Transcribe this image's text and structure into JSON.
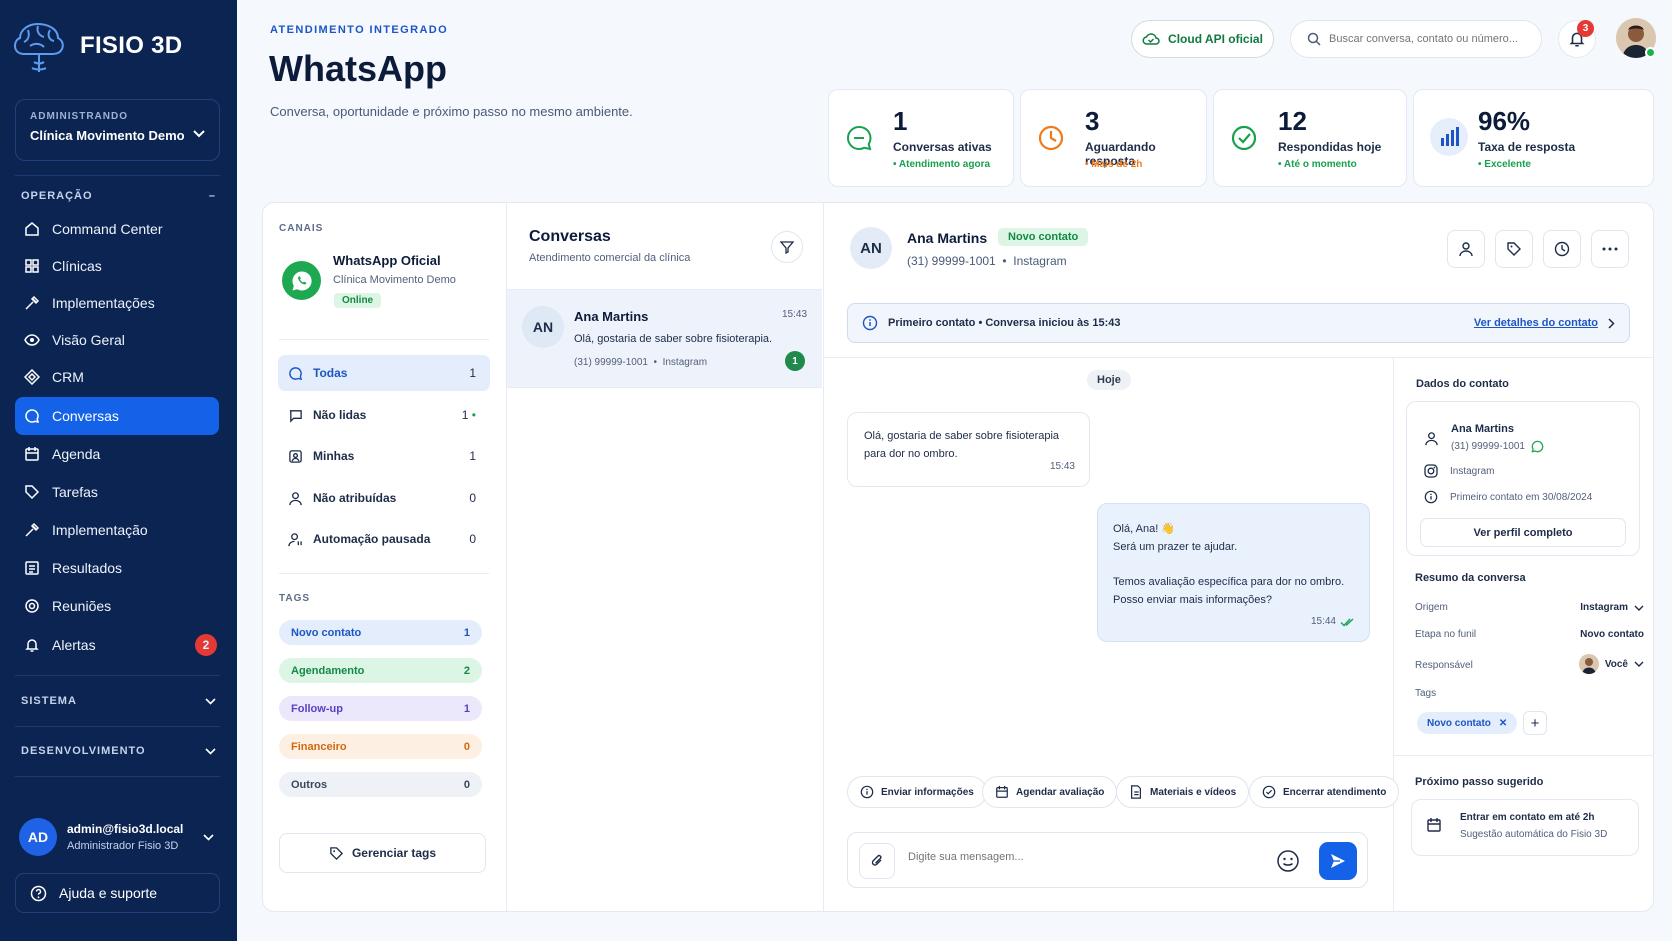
{
  "sidebar": {
    "brand": "FISIO 3D",
    "admin_label": "ADMINISTRANDO",
    "clinic": "Clínica Movimento Demo",
    "sections": {
      "operacao": "OPERAÇÃO",
      "sistema": "SISTEMA",
      "desenvolvimento": "DESENVOLVIMENTO"
    },
    "items": [
      {
        "label": "Command Center",
        "icon": "home-icon"
      },
      {
        "label": "Clínicas",
        "icon": "grid-icon"
      },
      {
        "label": "Implementações",
        "icon": "hammer-icon"
      },
      {
        "label": "Visão Geral",
        "icon": "eye-icon"
      },
      {
        "label": "CRM",
        "icon": "diamond-icon"
      },
      {
        "label": "Conversas",
        "icon": "chat-icon",
        "active": true
      },
      {
        "label": "Agenda",
        "icon": "calendar-icon"
      },
      {
        "label": "Tarefas",
        "icon": "tag-icon"
      },
      {
        "label": "Implementação",
        "icon": "hammer-icon"
      },
      {
        "label": "Resultados",
        "icon": "report-icon"
      },
      {
        "label": "Reuniões",
        "icon": "target-icon"
      },
      {
        "label": "Alertas",
        "icon": "bell-icon",
        "badge": "2"
      }
    ],
    "user": {
      "initials": "AD",
      "email": "admin@fisio3d.local",
      "role": "Administrador Fisio 3D"
    },
    "help": "Ajuda e suporte"
  },
  "header": {
    "eyebrow": "ATENDIMENTO INTEGRADO",
    "title": "WhatsApp",
    "subtitle": "Conversa, oportunidade e próximo passo no mesmo ambiente.",
    "cloud_api": "Cloud API oficial",
    "search_placeholder": "Buscar conversa, contato ou número...",
    "notifications": "3"
  },
  "stats": [
    {
      "value": "1",
      "label": "Conversas ativas",
      "sub": "Atendimento agora",
      "color": "#18a04f"
    },
    {
      "value": "3",
      "label": "Aguardando resposta",
      "sub": "Mais de 2h",
      "color": "#f07a1a"
    },
    {
      "value": "12",
      "label": "Respondidas hoje",
      "sub": "Até o momento",
      "color": "#18a04f"
    },
    {
      "value": "96%",
      "label": "Taxa de resposta",
      "sub": "Excelente",
      "color": "#18a04f"
    }
  ],
  "channels": {
    "label": "CANAIS",
    "name": "WhatsApp Oficial",
    "clinic": "Clínica Movimento Demo",
    "status": "Online",
    "filters": [
      {
        "label": "Todas",
        "count": "1"
      },
      {
        "label": "Não lidas",
        "count": "1"
      },
      {
        "label": "Minhas",
        "count": "1"
      },
      {
        "label": "Não atribuídas",
        "count": "0"
      },
      {
        "label": "Automação pausada",
        "count": "0"
      }
    ],
    "tags_label": "TAGS",
    "tags": [
      {
        "label": "Novo contato",
        "count": "1",
        "bg": "#e4edfb",
        "color": "#1d55c4"
      },
      {
        "label": "Agendamento",
        "count": "2",
        "bg": "#dcf5e4",
        "color": "#138a43"
      },
      {
        "label": "Follow-up",
        "count": "1",
        "bg": "#ece8fb",
        "color": "#5b3fc4"
      },
      {
        "label": "Financeiro",
        "count": "0",
        "bg": "#fdefe1",
        "color": "#d06a12"
      },
      {
        "label": "Outros",
        "count": "0",
        "bg": "#eef1f5",
        "color": "#3a4760"
      }
    ],
    "manage": "Gerenciar tags"
  },
  "conversations": {
    "title": "Conversas",
    "subtitle": "Atendimento comercial da clínica",
    "items": [
      {
        "initials": "AN",
        "name": "Ana Martins",
        "time": "15:43",
        "preview": "Olá, gostaria de saber sobre fisioterapia.",
        "phone": "(31) 99999-1001",
        "source": "Instagram",
        "unread": "1"
      }
    ]
  },
  "chat": {
    "initials": "AN",
    "name": "Ana Martins",
    "tag": "Novo contato",
    "phone": "(31) 99999-1001",
    "source": "Instagram",
    "info": "Primeiro contato • Conversa iniciou às 15:43",
    "info_link": "Ver detalhes do contato",
    "day": "Hoje",
    "msg_in": {
      "line1": "Olá, gostaria de saber sobre fisioterapia",
      "line2": "para dor no ombro.",
      "time": "15:43"
    },
    "msg_out": {
      "line1": "Olá, Ana! 👋",
      "line2": "Será um prazer te ajudar.",
      "line3": "Temos avaliação específica para dor no ombro.",
      "line4": "Posso enviar mais informações?",
      "time": "15:44"
    },
    "quick_actions": [
      "Enviar informações",
      "Agendar avaliação",
      "Materiais e vídeos",
      "Encerrar atendimento"
    ],
    "composer_placeholder": "Digite sua mensagem..."
  },
  "contact": {
    "title": "Dados do contato",
    "name": "Ana Martins",
    "phone": "(31) 99999-1001",
    "source": "Instagram",
    "first_contact": "Primeiro contato em 30/08/2024",
    "profile_btn": "Ver perfil completo",
    "summary_title": "Resumo da conversa",
    "summary": [
      {
        "label": "Origem",
        "value": "Instagram"
      },
      {
        "label": "Etapa no funil",
        "value": "Novo contato"
      },
      {
        "label": "Responsável",
        "value": "Você"
      }
    ],
    "tags_label": "Tags",
    "tag": "Novo contato",
    "next_title": "Próximo passo sugerido",
    "next_action": "Entrar em contato em até 2h",
    "next_sub": "Sugestão automática do Fisio 3D"
  }
}
